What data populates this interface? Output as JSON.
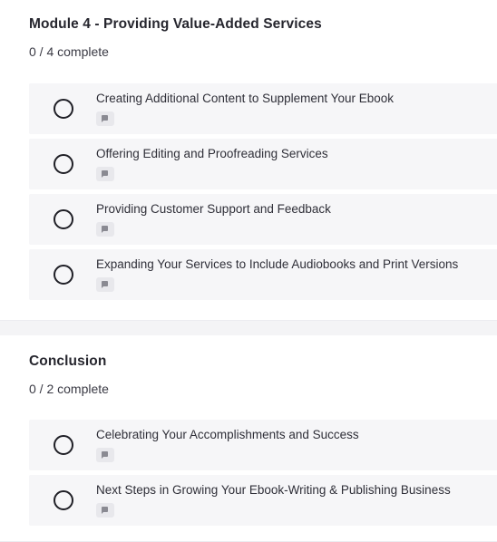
{
  "modules": [
    {
      "title": "Module 4 - Providing Value-Added Services",
      "progress": "0 / 4 complete",
      "lessons": [
        {
          "title": "Creating Additional Content to Supplement Your Ebook",
          "icon": "text-lesson-icon",
          "completed": false
        },
        {
          "title": "Offering Editing and Proofreading Services",
          "icon": "text-lesson-icon",
          "completed": false
        },
        {
          "title": "Providing Customer Support and Feedback",
          "icon": "text-lesson-icon",
          "completed": false
        },
        {
          "title": "Expanding Your Services to Include Audiobooks and Print Versions",
          "icon": "text-lesson-icon",
          "completed": false
        }
      ]
    },
    {
      "title": "Conclusion",
      "progress": "0 / 2 complete",
      "lessons": [
        {
          "title": "Celebrating Your Accomplishments and Success",
          "icon": "text-lesson-icon",
          "completed": false
        },
        {
          "title": "Next Steps in Growing Your Ebook-Writing & Publishing Business",
          "icon": "text-lesson-icon",
          "completed": false
        }
      ]
    }
  ]
}
